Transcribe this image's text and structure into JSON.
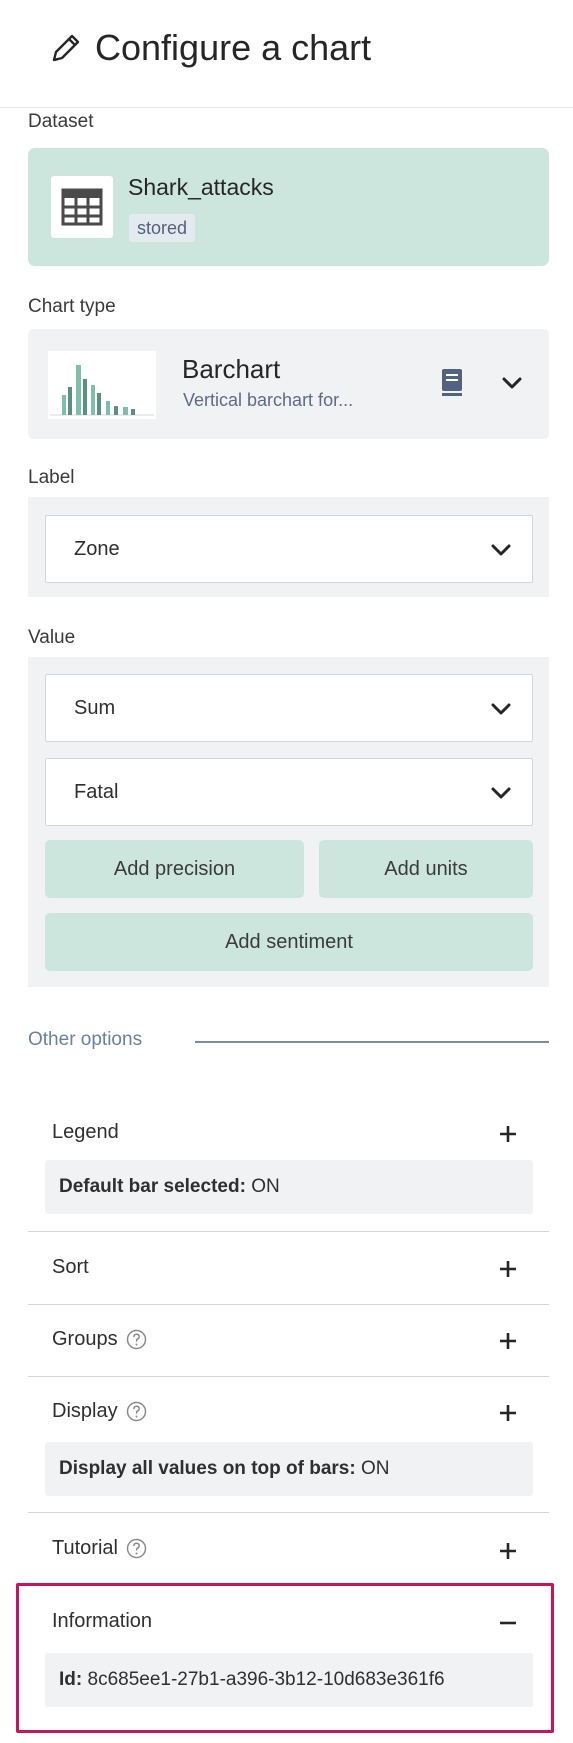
{
  "header": {
    "title": "Configure a chart",
    "icon": "pencil-icon"
  },
  "dataset": {
    "label": "Dataset",
    "name": "Shark_attacks",
    "badge": "stored",
    "icon": "table-icon",
    "color": "#cce6dd"
  },
  "chart_type": {
    "label": "Chart type",
    "name": "Barchart",
    "description": "Vertical barchart for...",
    "doc_icon": "book-icon",
    "thumbnail_icon": "barchart-thumbnail-icon"
  },
  "label_section": {
    "label": "Label",
    "select_value": "Zone"
  },
  "value_section": {
    "label": "Value",
    "aggregation": "Sum",
    "field": "Fatal",
    "add_precision": "Add precision",
    "add_units": "Add units",
    "add_sentiment": "Add sentiment"
  },
  "other_options": {
    "label": "Other options",
    "legend": {
      "title": "Legend",
      "setting_label": "Default bar selected:",
      "setting_value": "ON"
    },
    "sort": {
      "title": "Sort"
    },
    "groups": {
      "title": "Groups"
    },
    "display": {
      "title": "Display",
      "setting_label": "Display all values on top of bars:",
      "setting_value": "ON"
    },
    "tutorial": {
      "title": "Tutorial"
    },
    "information": {
      "title": "Information",
      "id_label": "Id:",
      "id_value": "8c685ee1-27b1-a396-3b12-10d683e361f6"
    }
  },
  "colors": {
    "accent_green": "#cce6dd",
    "panel_gray": "#f1f2f4",
    "highlight": "#c4155e",
    "muted_blue": "#6c7f9e"
  }
}
